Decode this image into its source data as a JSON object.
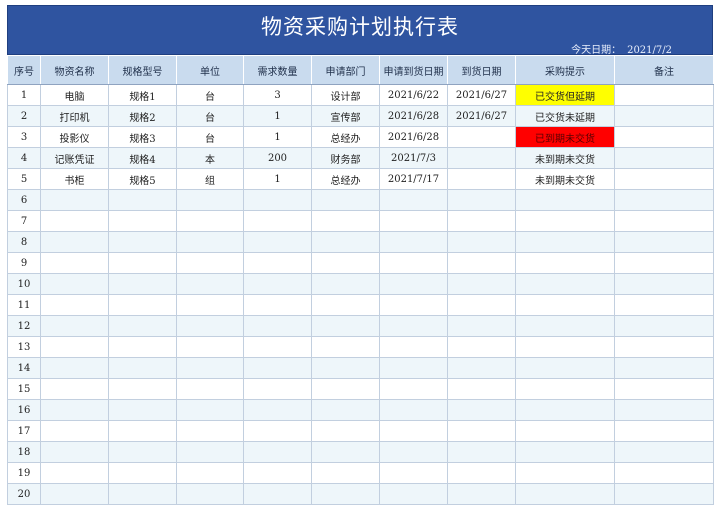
{
  "title": "物资采购计划执行表",
  "today_label": "今天日期：",
  "today_value": "2021/7/2",
  "headers": [
    "序号",
    "物资名称",
    "规格型号",
    "单位",
    "需求数量",
    "申请部门",
    "申请到货日期",
    "到货日期",
    "采购提示",
    "备注"
  ],
  "rows": [
    [
      "1",
      "电脑",
      "规格1",
      "台",
      "3",
      "设计部",
      "2021/6/22",
      "2021/6/27",
      "已交货但延期",
      ""
    ],
    [
      "2",
      "打印机",
      "规格2",
      "台",
      "1",
      "宣传部",
      "2021/6/28",
      "2021/6/27",
      "已交货未延期",
      ""
    ],
    [
      "3",
      "投影仪",
      "规格3",
      "台",
      "1",
      "总经办",
      "2021/6/28",
      "",
      "已到期未交货",
      ""
    ],
    [
      "4",
      "记账凭证",
      "规格4",
      "本",
      "200",
      "财务部",
      "2021/7/3",
      "",
      "未到期未交货",
      ""
    ],
    [
      "5",
      "书柜",
      "规格5",
      "组",
      "1",
      "总经办",
      "2021/7/17",
      "",
      "未到期未交货",
      ""
    ],
    [
      "6",
      "",
      "",
      "",
      "",
      "",
      "",
      "",
      "",
      ""
    ],
    [
      "7",
      "",
      "",
      "",
      "",
      "",
      "",
      "",
      "",
      ""
    ],
    [
      "8",
      "",
      "",
      "",
      "",
      "",
      "",
      "",
      "",
      ""
    ],
    [
      "9",
      "",
      "",
      "",
      "",
      "",
      "",
      "",
      "",
      ""
    ],
    [
      "10",
      "",
      "",
      "",
      "",
      "",
      "",
      "",
      "",
      ""
    ],
    [
      "11",
      "",
      "",
      "",
      "",
      "",
      "",
      "",
      "",
      ""
    ],
    [
      "12",
      "",
      "",
      "",
      "",
      "",
      "",
      "",
      "",
      ""
    ],
    [
      "13",
      "",
      "",
      "",
      "",
      "",
      "",
      "",
      "",
      ""
    ],
    [
      "14",
      "",
      "",
      "",
      "",
      "",
      "",
      "",
      "",
      ""
    ],
    [
      "15",
      "",
      "",
      "",
      "",
      "",
      "",
      "",
      "",
      ""
    ],
    [
      "16",
      "",
      "",
      "",
      "",
      "",
      "",
      "",
      "",
      ""
    ],
    [
      "17",
      "",
      "",
      "",
      "",
      "",
      "",
      "",
      "",
      ""
    ],
    [
      "18",
      "",
      "",
      "",
      "",
      "",
      "",
      "",
      "",
      ""
    ],
    [
      "19",
      "",
      "",
      "",
      "",
      "",
      "",
      "",
      "",
      ""
    ],
    [
      "20",
      "",
      "",
      "",
      "",
      "",
      "",
      "",
      "",
      ""
    ]
  ],
  "status_colors": {
    "已交货但延期": "#ffff00",
    "已到期未交货": "#ff0000"
  }
}
